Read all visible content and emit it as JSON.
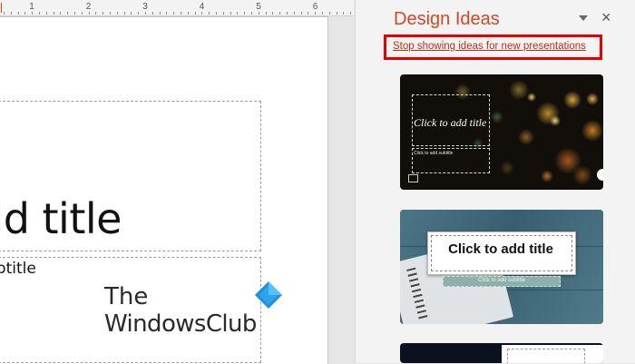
{
  "ruler": {
    "numbers": [
      "1",
      "2",
      "3",
      "4",
      "5",
      "6"
    ]
  },
  "slide": {
    "title_placeholder": "dd title",
    "subtitle_placeholder": "ubtitle"
  },
  "watermark": {
    "line1": "The",
    "line2": "WindowsClub"
  },
  "pane": {
    "title": "Design Ideas",
    "stop_link": "Stop showing ideas for new presentations",
    "accent_color": "#d24726",
    "highlight_color": "#e60000",
    "close_glyph": "×"
  },
  "thumbnails": [
    {
      "title": "Click to add title",
      "subtitle": "Click to add subtitle",
      "theme_icon": "fireworks-bokeh"
    },
    {
      "title": "Click to add title",
      "subtitle": "Click to add subtitle",
      "theme_icon": "notebook-wood"
    },
    {
      "theme_icon": "dark-starfield"
    }
  ]
}
